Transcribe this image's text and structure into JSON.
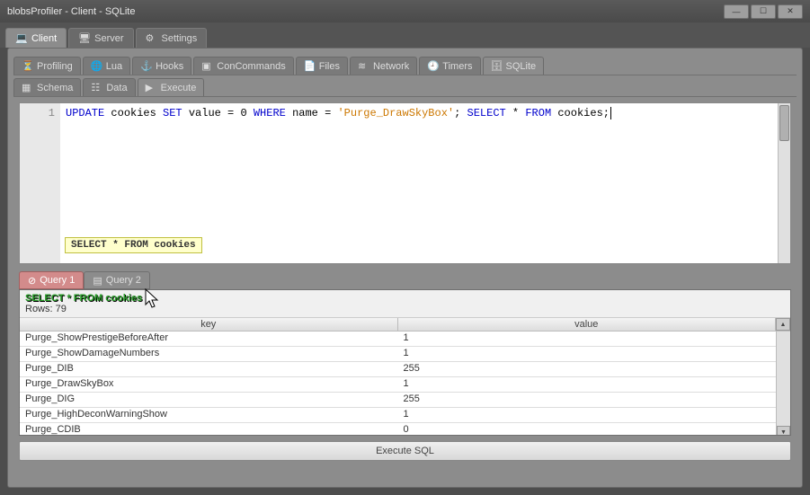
{
  "window": {
    "title": "blobsProfiler - Client - SQLite"
  },
  "main_tabs": [
    {
      "label": "Client",
      "icon": "client",
      "active": true
    },
    {
      "label": "Server",
      "icon": "server",
      "active": false
    },
    {
      "label": "Settings",
      "icon": "settings",
      "active": false
    }
  ],
  "module_tabs": [
    {
      "label": "Profiling",
      "icon": "hourglass",
      "active": false
    },
    {
      "label": "Lua",
      "icon": "globe",
      "active": false
    },
    {
      "label": "Hooks",
      "icon": "anchor",
      "active": false
    },
    {
      "label": "ConCommands",
      "icon": "terminal",
      "active": false
    },
    {
      "label": "Files",
      "icon": "files",
      "active": false
    },
    {
      "label": "Network",
      "icon": "network",
      "active": false
    },
    {
      "label": "Timers",
      "icon": "clock",
      "active": false
    },
    {
      "label": "SQLite",
      "icon": "db",
      "active": true
    }
  ],
  "sqlite_tabs": [
    {
      "label": "Schema",
      "icon": "schema",
      "active": false
    },
    {
      "label": "Data",
      "icon": "data",
      "active": false
    },
    {
      "label": "Execute",
      "icon": "play",
      "active": true
    }
  ],
  "editor": {
    "line_no": "1",
    "code_parts": {
      "p1": "UPDATE",
      "p2": " cookies ",
      "p3": "SET",
      "p4": " value = 0 ",
      "p5": "WHERE",
      "p6": " name = ",
      "p7": "'Purge_DrawSkyBox'",
      "p8": "; ",
      "p9": "SELECT",
      "p10": " * ",
      "p11": "FROM",
      "p12": " cookies;"
    },
    "tooltip": "SELECT * FROM cookies"
  },
  "result_tabs": [
    {
      "label": "Query 1",
      "variant": "error"
    },
    {
      "label": "Query 2",
      "variant": "active"
    }
  ],
  "results": {
    "query_text": "SELECT * FROM cookies",
    "row_count_label": "Rows: 79",
    "columns": [
      "key",
      "value"
    ],
    "rows": [
      {
        "key": "Purge_ShowPrestigeBeforeAfter",
        "value": "1"
      },
      {
        "key": "Purge_ShowDamageNumbers",
        "value": "1"
      },
      {
        "key": "Purge_DIB",
        "value": "255"
      },
      {
        "key": "Purge_DrawSkyBox",
        "value": "1"
      },
      {
        "key": "Purge_DIG",
        "value": "255"
      },
      {
        "key": "Purge_HighDeconWarningShow",
        "value": "1"
      },
      {
        "key": "Purge_CDIB",
        "value": "0"
      }
    ]
  },
  "execute_button": "Execute SQL",
  "icons": {
    "client": "💻",
    "server": "🖥",
    "settings": "⚙",
    "hourglass": "⏳",
    "globe": "🌐",
    "anchor": "⚓",
    "terminal": "▣",
    "files": "📄",
    "network": "≋",
    "clock": "🕘",
    "db": "🗄",
    "schema": "▦",
    "data": "☷",
    "play": "▶",
    "query_err": "⊘",
    "query_ok": "▤"
  }
}
